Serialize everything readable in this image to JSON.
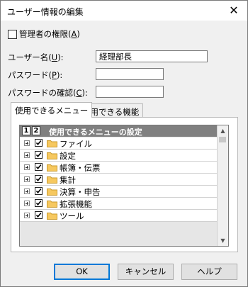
{
  "window": {
    "title": "ユーザー情報の編集",
    "close_glyph": "✕"
  },
  "admin_checkbox": {
    "label_pre": "管理者の権限(",
    "accel": "A",
    "label_post": ")",
    "checked": false
  },
  "username": {
    "label_pre": "ユーザー名(",
    "accel": "U",
    "label_post": "):",
    "value": "経理部長"
  },
  "password": {
    "label_pre": "パスワード(",
    "accel": "P",
    "label_post": "):",
    "value": ""
  },
  "password_confirm": {
    "label_pre": "パスワードの確認(",
    "accel": "C",
    "label_post": "):",
    "value": ""
  },
  "tabs": [
    {
      "label": "使用できるメニュー",
      "active": true
    },
    {
      "label": "使用できる機能",
      "active": false
    }
  ],
  "grid": {
    "level_1": "1",
    "level_2": "2",
    "header": "使用できるメニューの設定",
    "rows": [
      {
        "label": "ファイル",
        "checked": true
      },
      {
        "label": "設定",
        "checked": true
      },
      {
        "label": "帳簿・伝票",
        "checked": true
      },
      {
        "label": "集計",
        "checked": true
      },
      {
        "label": "決算・申告",
        "checked": true
      },
      {
        "label": "拡張機能",
        "checked": true
      },
      {
        "label": "ツール",
        "checked": true
      }
    ]
  },
  "buttons": {
    "ok": "OK",
    "cancel": "キャンセル",
    "help": "ヘルプ"
  },
  "colors": {
    "grid_header_bg": "#808080",
    "folder": "#f6c85f",
    "default_button_border": "#0078d7"
  }
}
